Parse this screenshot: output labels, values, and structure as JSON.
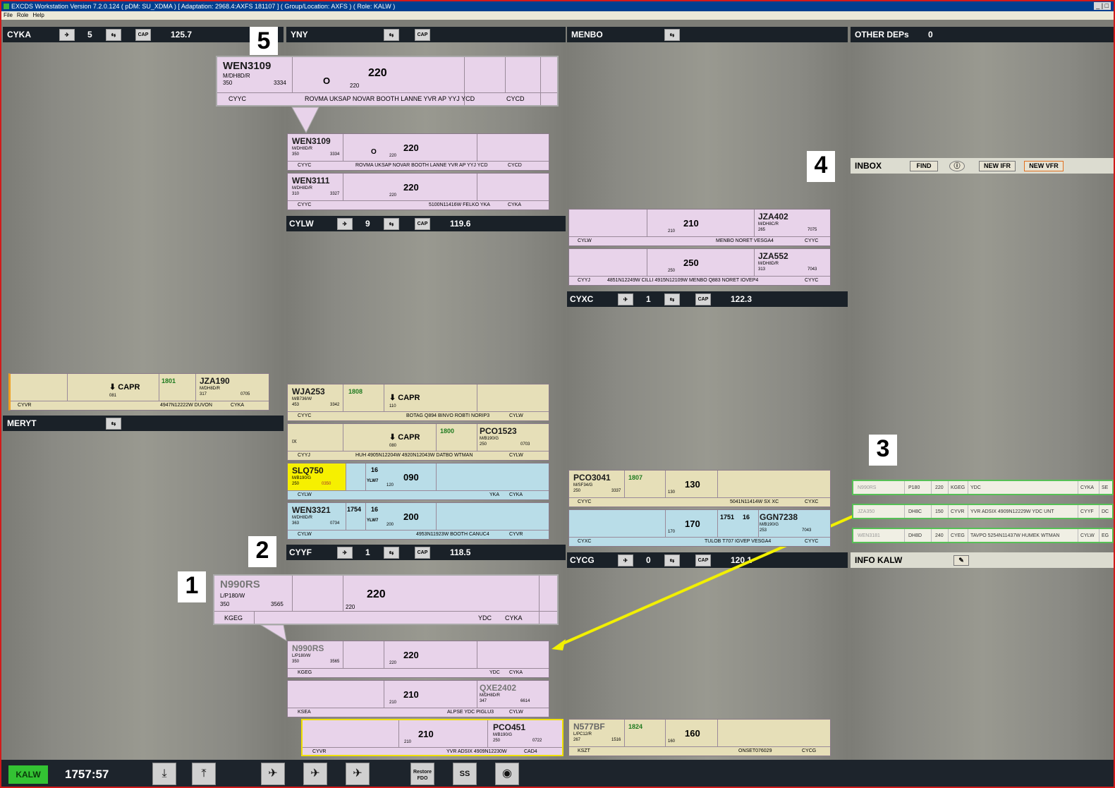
{
  "window": {
    "title": "EXCDS Workstation Version 7.2.0.124 ( pDM: SU_XDMA ) [ Adaptation: 2968.4:AXFS 181107 ] ( Group/Location: AXFS ) ( Role: KALW )",
    "controls": "_ | □"
  },
  "menu": [
    "File",
    "Role",
    "Help"
  ],
  "bays": {
    "cyka": {
      "name": "CYKA",
      "count": "5",
      "freq": "125.7"
    },
    "yny": {
      "name": "YNY"
    },
    "menbo": {
      "name": "MENBO"
    },
    "otherdeps": {
      "name": "OTHER DEPs",
      "count": "0"
    },
    "cylw": {
      "name": "CYLW",
      "count": "9",
      "freq": "119.6"
    },
    "cyxc": {
      "name": "CYXC",
      "count": "1",
      "freq": "122.3"
    },
    "meryt": {
      "name": "MERYT"
    },
    "cyyf": {
      "name": "CYYF",
      "count": "1",
      "freq": "118.5"
    },
    "cycg": {
      "name": "CYCG",
      "count": "0",
      "freq": "120.1"
    },
    "inbox": {
      "name": "INBOX",
      "find": "FIND",
      "new_ifr": "NEW IFR",
      "new_vfr": "NEW VFR"
    },
    "info": {
      "name": "INFO KALW"
    }
  },
  "icons": {
    "cap": "CAP",
    "swap": "⇆"
  },
  "strips": {
    "wen3109_zoom": {
      "cs": "WEN3109",
      "type": "M/DH8D/R",
      "a1": "350",
      "sq": "3334",
      "o": "O",
      "alt": "220",
      "alt2": "220",
      "dep": "CYYC",
      "route": "ROVMA UKSAP NOVAR BOOTH LANNE YVR AP YYJ YCD",
      "dest": "CYCD"
    },
    "wen3109": {
      "cs": "WEN3109",
      "type": "M/DH8D/R",
      "a1": "350",
      "sq": "3334",
      "o": "O",
      "alt": "220",
      "alt2": "220",
      "dep": "CYYC",
      "route": "ROVMA UKSAP NOVAR BOOTH LANNE YVR AP YYJ YCD",
      "dest": "CYCD"
    },
    "wen3111": {
      "cs": "WEN3111",
      "type": "M/DH8D/R",
      "a1": "310",
      "sq": "3327",
      "alt": "220",
      "alt2": "220",
      "dep": "CYYC",
      "route": "5100N11416W FELKO YKA",
      "dest": "CYKA"
    },
    "jza402": {
      "cs": "JZA402",
      "type": "M/DH8C/R",
      "a1": "265",
      "sq": "7075",
      "alt": "210",
      "alt2": "210",
      "dep": "CYLW",
      "route": "MENBO NORET VESGA4",
      "dest": "CYYC"
    },
    "jza552": {
      "cs": "JZA552",
      "type": "M/DH8D/R",
      "a1": "313",
      "sq": "7043",
      "alt": "250",
      "alt2": "250",
      "dep": "CYYJ",
      "route": "4851N12249W CILLI 4915N12109W MENBO Q883 NORET IOVEP4",
      "dest": "CYYC"
    },
    "jza190": {
      "cs": "JZA190",
      "type": "M/DH8D/R",
      "a1": "317",
      "sq": "0705",
      "time": "1801",
      "capr": "CAPR",
      "alt2": "081",
      "dep": "CYVR",
      "route": "4947N12222W DUVON",
      "dest": "CYKA"
    },
    "wja253": {
      "cs": "WJA253",
      "type": "M/B736/W",
      "a1": "453",
      "sq": "3342",
      "time": "1808",
      "capr": "CAPR",
      "alt2": "110",
      "dep": "CYYC",
      "route": "BOTAG Q894 BINVO ROBTI NORIP3",
      "dest": "CYLW"
    },
    "pco1523": {
      "cs": "PCO1523",
      "type": "M/B190/G",
      "a1": "250",
      "sq": "0703",
      "time": "1800",
      "capr": "CAPR",
      "alt2": "080",
      "ix": "IX",
      "dep": "CYYJ",
      "route": "HUH 4905N12204W 4920N12043W DATBO WTMAN",
      "dest": "CYLW"
    },
    "slq750": {
      "cs": "SLQ750",
      "type": "M/B190/G",
      "a1": "250",
      "sq": "0350",
      "n16": "16",
      "ylw": "YLW7",
      "alt": "090",
      "alt2": "120",
      "dep": "CYLW",
      "route": "YKA",
      "dest": "CYKA"
    },
    "wen3321": {
      "cs": "WEN3321",
      "type": "M/DH8D/R",
      "a1": "363",
      "sq": "0734",
      "time": "1754",
      "n16": "16",
      "ylw": "YLW7",
      "alt": "200",
      "alt2": "200",
      "dep": "CYLW",
      "route": "4953N11923W BOOTH CANUC4",
      "dest": "CYVR"
    },
    "pco3041": {
      "cs": "PCO3041",
      "type": "M/SF34/G",
      "a1": "250",
      "sq": "3337",
      "time": "1807",
      "alt": "130",
      "alt2": "130",
      "dep": "CYYC",
      "route": "5041N11414W SX XC",
      "dest": "CYXC"
    },
    "ggn7238": {
      "cs": "GGN7238",
      "type": "M/B190/G",
      "a1": "253",
      "sq": "7043",
      "time": "1751",
      "n16": "16",
      "alt": "170",
      "alt2": "170",
      "dep": "CYXC",
      "route": "TULOB T707 IGVEP VESGA4",
      "dest": "CYYC"
    },
    "n990rs_zoom": {
      "cs": "N990RS",
      "type": "L/P180/W",
      "a1": "350",
      "sq": "3565",
      "alt": "220",
      "alt2": "220",
      "dep": "KGEG",
      "route": "YDC",
      "dest": "CYKA"
    },
    "n990rs": {
      "cs": "N990RS",
      "type": "L/P180/W",
      "a1": "350",
      "sq": "3565",
      "alt": "220",
      "alt2": "220",
      "dep": "KGEG",
      "route": "YDC",
      "dest": "CYKA"
    },
    "qxe2402": {
      "cs": "QXE2402",
      "type": "M/DH8D/R",
      "a1": "347",
      "sq": "6614",
      "alt": "210",
      "alt2": "210",
      "dep": "KSEA",
      "route": "ALPSE YDC PIGLU3",
      "dest": "CYLW"
    },
    "pco451": {
      "cs": "PCO451",
      "type": "M/B190/G",
      "a1": "250",
      "sq": "0722",
      "alt": "210",
      "alt2": "210",
      "dep": "CYVR",
      "route": "YVR ADSIX 4909N12230W",
      "dest": "CAD4"
    },
    "n577bf": {
      "cs": "N577BF",
      "type": "L/PC12/R",
      "a1": "267",
      "sq": "1516",
      "time": "1824",
      "alt": "160",
      "alt2": "160",
      "dep": "KSZT",
      "route": "ONSET076029",
      "dest": "CYCG"
    }
  },
  "inbox_rows": [
    {
      "cs": "N990RS",
      "type": "P180",
      "alt": "220",
      "dep": "KGEG",
      "route": "YDC",
      "dest": "CYKA",
      "extra": "SE"
    },
    {
      "cs": "JZA350",
      "type": "DH8C",
      "alt": "150",
      "dep": "CYVR",
      "route": "YVR ADSIX 4909N12229W YDC UNT",
      "dest": "CYYF",
      "extra": "DC"
    },
    {
      "cs": "WEN3181",
      "type": "DH8D",
      "alt": "240",
      "dep": "CYEG",
      "route": "TAVPO 5254N11437W HUMEK WTMAN",
      "dest": "CYLW",
      "extra": "EG"
    }
  ],
  "callouts": [
    "1",
    "2",
    "3",
    "4",
    "5"
  ],
  "taskbar": {
    "position": "KALW",
    "clock": "1757:57",
    "restore_fdo": "Restore FDO",
    "ss": "SS"
  },
  "colors": {
    "pink_strip": "#e8d3ea",
    "tan_strip": "#e6dfb8",
    "blue_strip": "#b9dde8",
    "header": "#1a2128",
    "highlight": "#f6f000",
    "arrow": "#f2f000",
    "inbox_border": "#56c056"
  }
}
